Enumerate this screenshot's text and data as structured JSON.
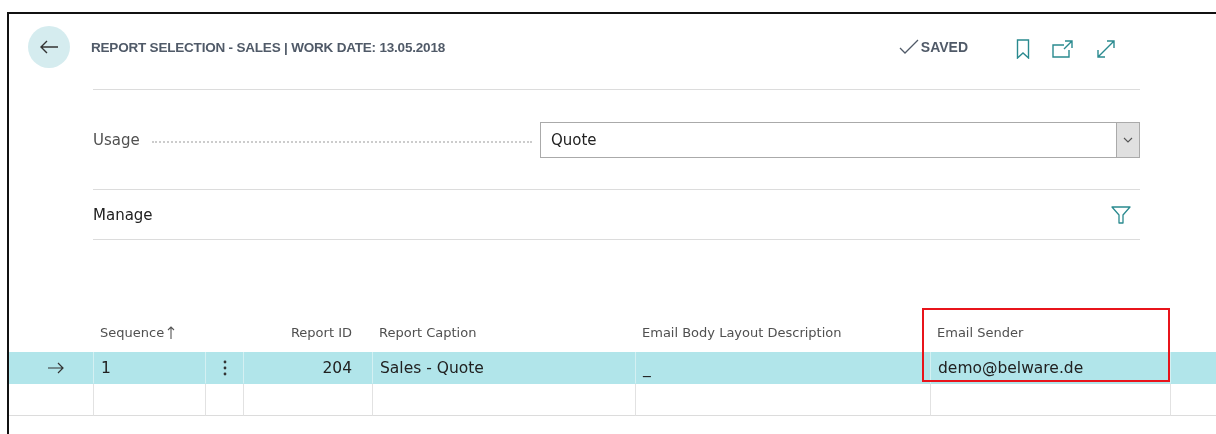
{
  "header": {
    "title": "REPORT SELECTION - SALES | WORK DATE: 13.05.2018",
    "status": "SAVED"
  },
  "usage": {
    "label": "Usage",
    "value": "Quote"
  },
  "manage": {
    "label": "Manage"
  },
  "table": {
    "columns": [
      {
        "label": "Sequence",
        "sorted_ascending": true
      },
      {
        "label": "Report ID",
        "numeric": true
      },
      {
        "label": "Report Caption"
      },
      {
        "label": "Email Body Layout Description"
      },
      {
        "label": "Email Sender",
        "highlighted": true
      }
    ],
    "rows": [
      {
        "selected": true,
        "cells": [
          "1",
          "204",
          "Sales - Quote",
          "_",
          "demo@belware.de"
        ]
      },
      {
        "selected": false
      }
    ]
  }
}
